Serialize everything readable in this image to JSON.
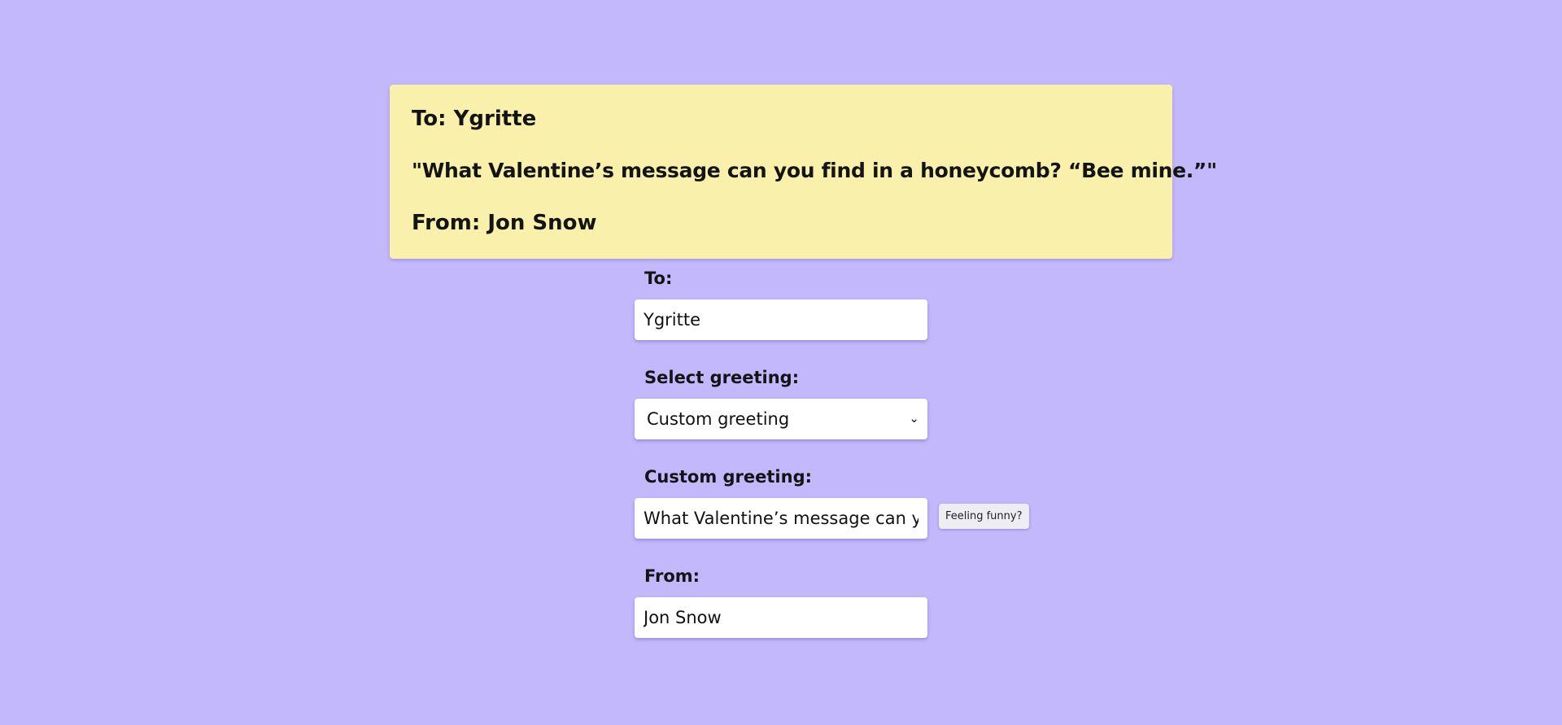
{
  "card": {
    "to_line": "To: Ygritte",
    "greeting_line": "\"What Valentine’s message can you find in a honeycomb? “Bee mine.”\"",
    "from_line": "From: Jon Snow"
  },
  "form": {
    "to_label": "To:",
    "to_value": "Ygritte",
    "greeting_select_label": "Select greeting:",
    "greeting_select_value": "Custom greeting",
    "custom_greeting_label": "Custom greeting:",
    "custom_greeting_value": "What Valentine’s message can you find in a honeycomb? “Bee mine.”",
    "funny_button_label": "Feeling funny?",
    "from_label": "From:",
    "from_value": "Jon Snow"
  },
  "colors": {
    "background": "#c4b8fd",
    "card": "#f9f1ab"
  },
  "icons": {
    "select_chevron": "chevron-down-icon"
  }
}
